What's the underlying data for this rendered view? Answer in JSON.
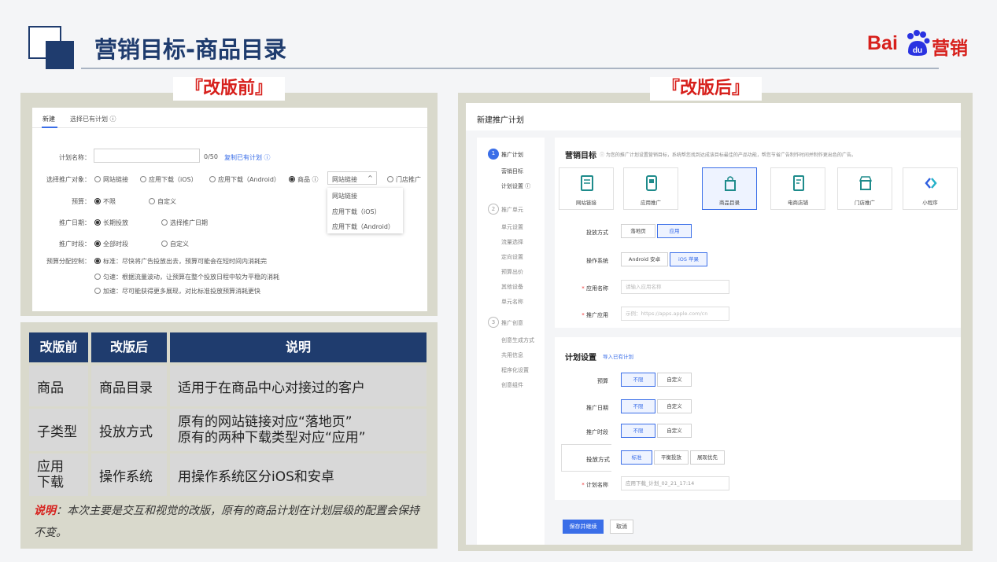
{
  "slide": {
    "title": "营销目标-商品目录",
    "brand": {
      "bai": "Bai",
      "du": "du",
      "ying": "营销"
    },
    "before_tag": "『改版前』",
    "after_tag": "『改版后』"
  },
  "old_form": {
    "tabs": [
      "新建",
      "选择已有计划 ⓘ"
    ],
    "plan_name_label": "计划名称：",
    "plan_name_count": "0/50",
    "copy_link": "复制已有计划 ⓘ",
    "target_label": "选择推广对象：",
    "target_options": [
      "网站链接",
      "应用下载（iOS）",
      "应用下载（Android）",
      "商品 ⓘ",
      "门店推广"
    ],
    "target_select": "网站链接",
    "dropdown": [
      "网站链接",
      "应用下载（iOS）",
      "应用下载（Android）"
    ],
    "budget_label": "预算：",
    "budget_options": [
      "不限",
      "自定义"
    ],
    "date_label": "推广日期：",
    "date_options": [
      "长期投放",
      "选择推广日期"
    ],
    "time_label": "推广时段：",
    "time_options": [
      "全部时段",
      "自定义"
    ],
    "alloc_label": "预算分配控制：",
    "alloc_options": [
      "标准：尽快将广告投放出去，预算可能会在短时间内消耗完",
      "匀速：根据流量波动，让预算在整个投放日程中较为平稳的消耗",
      "加速：尽可能获得更多展现，对比标准投放预算消耗更快"
    ]
  },
  "table": {
    "headers": [
      "改版前",
      "改版后",
      "说明"
    ],
    "rows": [
      [
        "商品",
        "商品目录",
        "适用于在商品中心对接过的客户"
      ],
      [
        "子类型",
        "投放方式",
        "原有的网站链接对应“落地页”\n原有的两种下载类型对应“应用”"
      ],
      [
        "应用下载",
        "操作系统",
        "用操作系统区分iOS和安卓"
      ]
    ],
    "note_em": "说明",
    "note_text": "：本次主要是交互和视觉的改版，原有的商品计划在计划层级的配置会保持不变。"
  },
  "new_form": {
    "window_title": "新建推广计划",
    "steps": [
      {
        "num": "1",
        "title": "推广计划",
        "items": [
          "营销目标",
          "计划设置 ⓘ"
        ]
      },
      {
        "num": "2",
        "title": "推广单元",
        "items": [
          "单元设置",
          "流量选择",
          "定向设置",
          "预算出价",
          "其他设备",
          "单元名称"
        ]
      },
      {
        "num": "3",
        "title": "推广创意",
        "items": [
          "创意生成方式",
          "共用信息",
          "程序化设置",
          "创意组件"
        ]
      }
    ],
    "goal_title": "营销目标",
    "goal_hint": "ⓘ 为您的推广计划设置营销目标，系统帮您找到达成该目标最佳的产品功能，帮您节省广告制作时间并制作更出色的广告。",
    "tiles": [
      "网站链接",
      "应用推广",
      "商品目录",
      "电商店铺",
      "门店推广",
      "小程序"
    ],
    "delivery_label": "投放方式",
    "delivery_options": [
      "落地页",
      "应用"
    ],
    "os_label": "操作系统",
    "os_options": [
      "Android 安卓",
      "iOS 苹果"
    ],
    "app_name_label": "应用名称",
    "app_name_placeholder": "请输入应用名称",
    "app_promo_label": "推广应用",
    "app_promo_placeholder": "示例：https://apps.apple.com/cn",
    "plan_settings_title": "计划设置",
    "import_link": "导入已有计划",
    "budget_label": "预算",
    "date_label": "推广日期",
    "time_label": "推广时段",
    "seg_options": [
      "不限",
      "自定义"
    ],
    "alloc_label": "投放方式",
    "alloc_options": [
      "标准",
      "平衡投放",
      "展现优先"
    ],
    "plan_name_label": "计划名称",
    "plan_name_value": "应用下载_计划_02_21_17:14",
    "save_button": "保存并继续",
    "cancel_button": "取消"
  },
  "colors": {
    "navy": "#1f3c6e",
    "brand_red": "#d7201c",
    "blue": "#3a6ee8"
  }
}
